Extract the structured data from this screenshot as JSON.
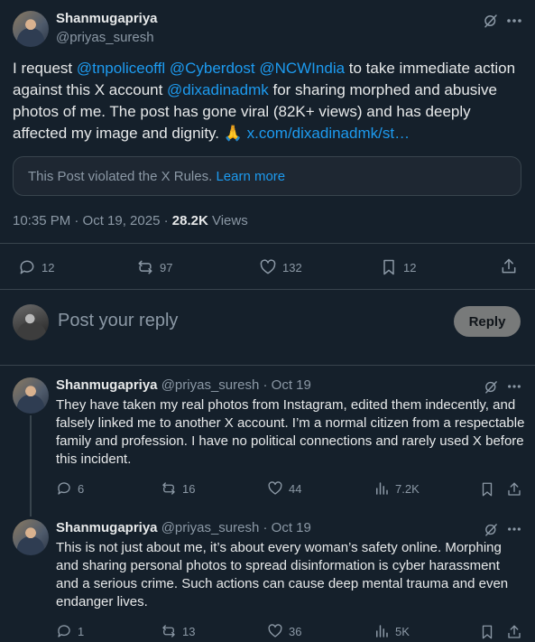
{
  "main_post": {
    "author_name": "Shanmugapriya",
    "author_handle": "@priyas_suresh",
    "text_parts": [
      {
        "t": "I request ",
        "link": false
      },
      {
        "t": "@tnpoliceoffl",
        "link": true
      },
      {
        "t": " ",
        "link": false
      },
      {
        "t": "@Cyberdost",
        "link": true
      },
      {
        "t": " ",
        "link": false
      },
      {
        "t": "@NCWIndia",
        "link": true
      },
      {
        "t": " to take immediate action against this X account ",
        "link": false
      },
      {
        "t": "@dixadinadmk",
        "link": true
      },
      {
        "t": " for sharing morphed and abusive photos of me. The post has gone viral (82K+ views) and has deeply affected my image and dignity. 🙏 ",
        "link": false
      },
      {
        "t": "x.com/dixadinadmk/st…",
        "link": true
      }
    ],
    "violation_text": "This Post violated the X Rules.",
    "violation_link": "Learn more",
    "timestamp": "10:35 PM · Oct 19, 2025",
    "separator": "·",
    "views_count": "28.2K",
    "views_label": "Views",
    "stats": {
      "replies": "12",
      "reposts": "97",
      "likes": "132",
      "bookmarks": "12"
    }
  },
  "reply_box": {
    "placeholder": "Post your reply",
    "button_label": "Reply"
  },
  "replies": [
    {
      "author_name": "Shanmugapriya",
      "author_handle": "@priyas_suresh",
      "date": "· Oct 19",
      "text": "They have taken my real photos from Instagram, edited them indecently, and falsely linked me to another X account. I’m a normal citizen from a respectable family and profession. I have no political connections and rarely used X before this incident.",
      "replies": "6",
      "reposts": "16",
      "likes": "44",
      "views": "7.2K"
    },
    {
      "author_name": "Shanmugapriya",
      "author_handle": "@priyas_suresh",
      "date": "· Oct 19",
      "text": "This is not just about me, it’s about every woman’s safety online. Morphing and sharing personal photos to spread disinformation is cyber harassment and a serious crime. Such actions can cause deep mental trauma and even endanger lives.",
      "replies": "1",
      "reposts": "13",
      "likes": "36",
      "views": "5K"
    }
  ],
  "colors": {
    "background": "#15202b",
    "text": "#e7e9ea",
    "muted": "#8b98a5",
    "link": "#1d9bf0",
    "border": "#38444d"
  }
}
